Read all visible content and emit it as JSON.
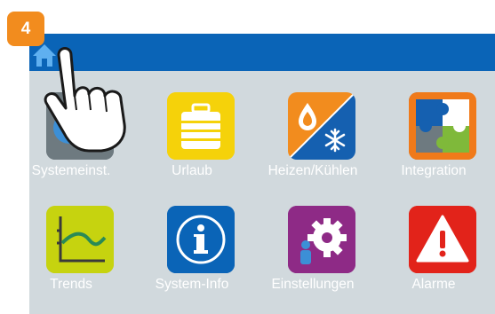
{
  "step": {
    "number": "4"
  },
  "topbar": {
    "home_icon": "home-icon",
    "accent": "#0a64b7"
  },
  "tiles": [
    {
      "label": "Systemeinst.",
      "icon": "system-settings-icon",
      "color": "#6e7a80"
    },
    {
      "label": "Urlaub",
      "icon": "suitcase-icon",
      "color": "#f5d20a"
    },
    {
      "label": "Heizen/Kühlen",
      "icon": "heat-cool-icon",
      "color": "#f28c1e"
    },
    {
      "label": "Integration",
      "icon": "puzzle-icon",
      "color": "#f07a1a"
    },
    {
      "label": "Trends",
      "icon": "trends-icon",
      "color": "#c6d30f"
    },
    {
      "label": "System-Info",
      "icon": "info-icon",
      "color": "#0a64b7"
    },
    {
      "label": "Einstellungen",
      "icon": "gear-person-icon",
      "color": "#8e2a86"
    },
    {
      "label": "Alarme",
      "icon": "warning-icon",
      "color": "#e2231a"
    }
  ],
  "pointer": {
    "icon": "hand-pointer-icon"
  }
}
